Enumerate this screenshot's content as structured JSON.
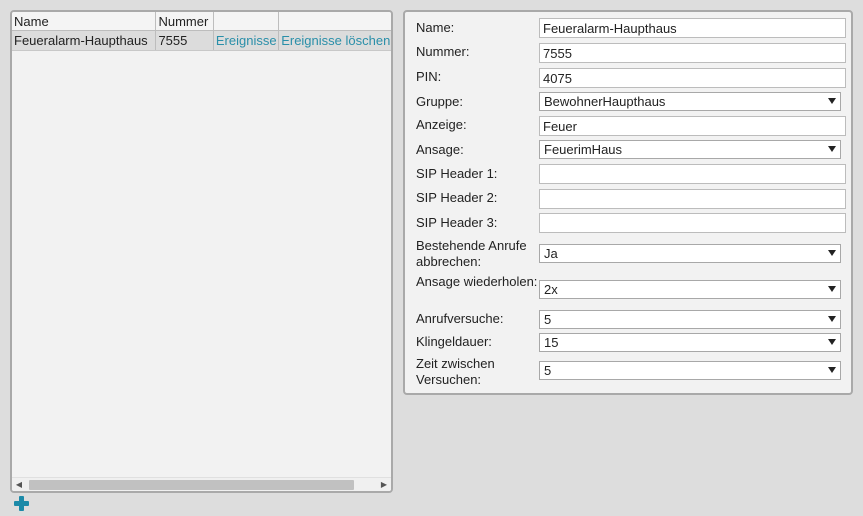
{
  "list": {
    "columns": [
      "Name",
      "Nummer",
      "",
      ""
    ],
    "rows": [
      {
        "name": "Feueralarm-Haupthaus",
        "nummer": "7555",
        "events": "Ereignisse",
        "delete_events": "Ereignisse löschen"
      }
    ]
  },
  "form": {
    "name_label": "Name:",
    "name_value": "Feueralarm-Haupthaus",
    "nummer_label": "Nummer:",
    "nummer_value": "7555",
    "pin_label": "PIN:",
    "pin_value": "4075",
    "gruppe_label": "Gruppe:",
    "gruppe_value": "BewohnerHaupthaus",
    "anzeige_label": "Anzeige:",
    "anzeige_value": "Feuer",
    "ansage_label": "Ansage:",
    "ansage_value": "FeuerimHaus",
    "sip1_label": "SIP Header 1:",
    "sip1_value": "",
    "sip2_label": "SIP Header 2:",
    "sip2_value": "",
    "sip3_label": "SIP Header 3:",
    "sip3_value": "",
    "abbrechen_label": "Bestehende Anrufe abbrechen:",
    "abbrechen_value": "Ja",
    "wiederholen_label": "Ansage wiederholen:",
    "wiederholen_value": "2x",
    "versuche_label": "Anrufversuche:",
    "versuche_value": "5",
    "klingel_label": "Klingeldauer:",
    "klingel_value": "15",
    "zeit_label": "Zeit zwischen Versuchen:",
    "zeit_value": "5"
  },
  "icons": {
    "add": "plus-icon",
    "scroll_left": "arrow-left-icon",
    "scroll_right": "arrow-right-icon",
    "caret": "caret-down-icon"
  },
  "colors": {
    "link": "#2a8fa9",
    "accent": "#1c8aa8",
    "selected_row": "#dcdcdc"
  }
}
